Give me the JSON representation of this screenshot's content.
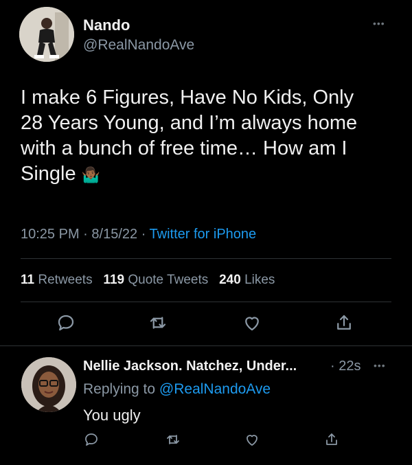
{
  "tweet": {
    "author_name": "Nando",
    "author_handle": "@RealNandoAve",
    "text_line1": "I make 6 Figures, Have No Kids, Only",
    "text_line2": "28 Years Young, and I’m always home",
    "text_line3": "with a bunch of free time… How am I",
    "text_line4": "Single",
    "emoji": "🤷🏾‍♂️",
    "time": "10:25 PM",
    "date": "8/15/22",
    "source": "Twitter for iPhone",
    "retweets": "11",
    "retweets_label": "Retweets",
    "quote_tweets": "119",
    "quote_tweets_label": "Quote Tweets",
    "likes": "240",
    "likes_label": "Likes",
    "more_icon": "more-icon"
  },
  "reply": {
    "author_name": "Nellie Jackson. Natchez, Under...",
    "time": "22s",
    "replying_label": "Replying to",
    "replying_handle": "@RealNandoAve",
    "text": "You ugly"
  },
  "icons": [
    "reply-icon",
    "retweet-icon",
    "like-icon",
    "share-icon"
  ],
  "colors": {
    "background": "#000000",
    "text": "#e7e9ea",
    "secondary": "#8b98a5",
    "link": "#1d9bf0",
    "divider": "#2f3336"
  }
}
